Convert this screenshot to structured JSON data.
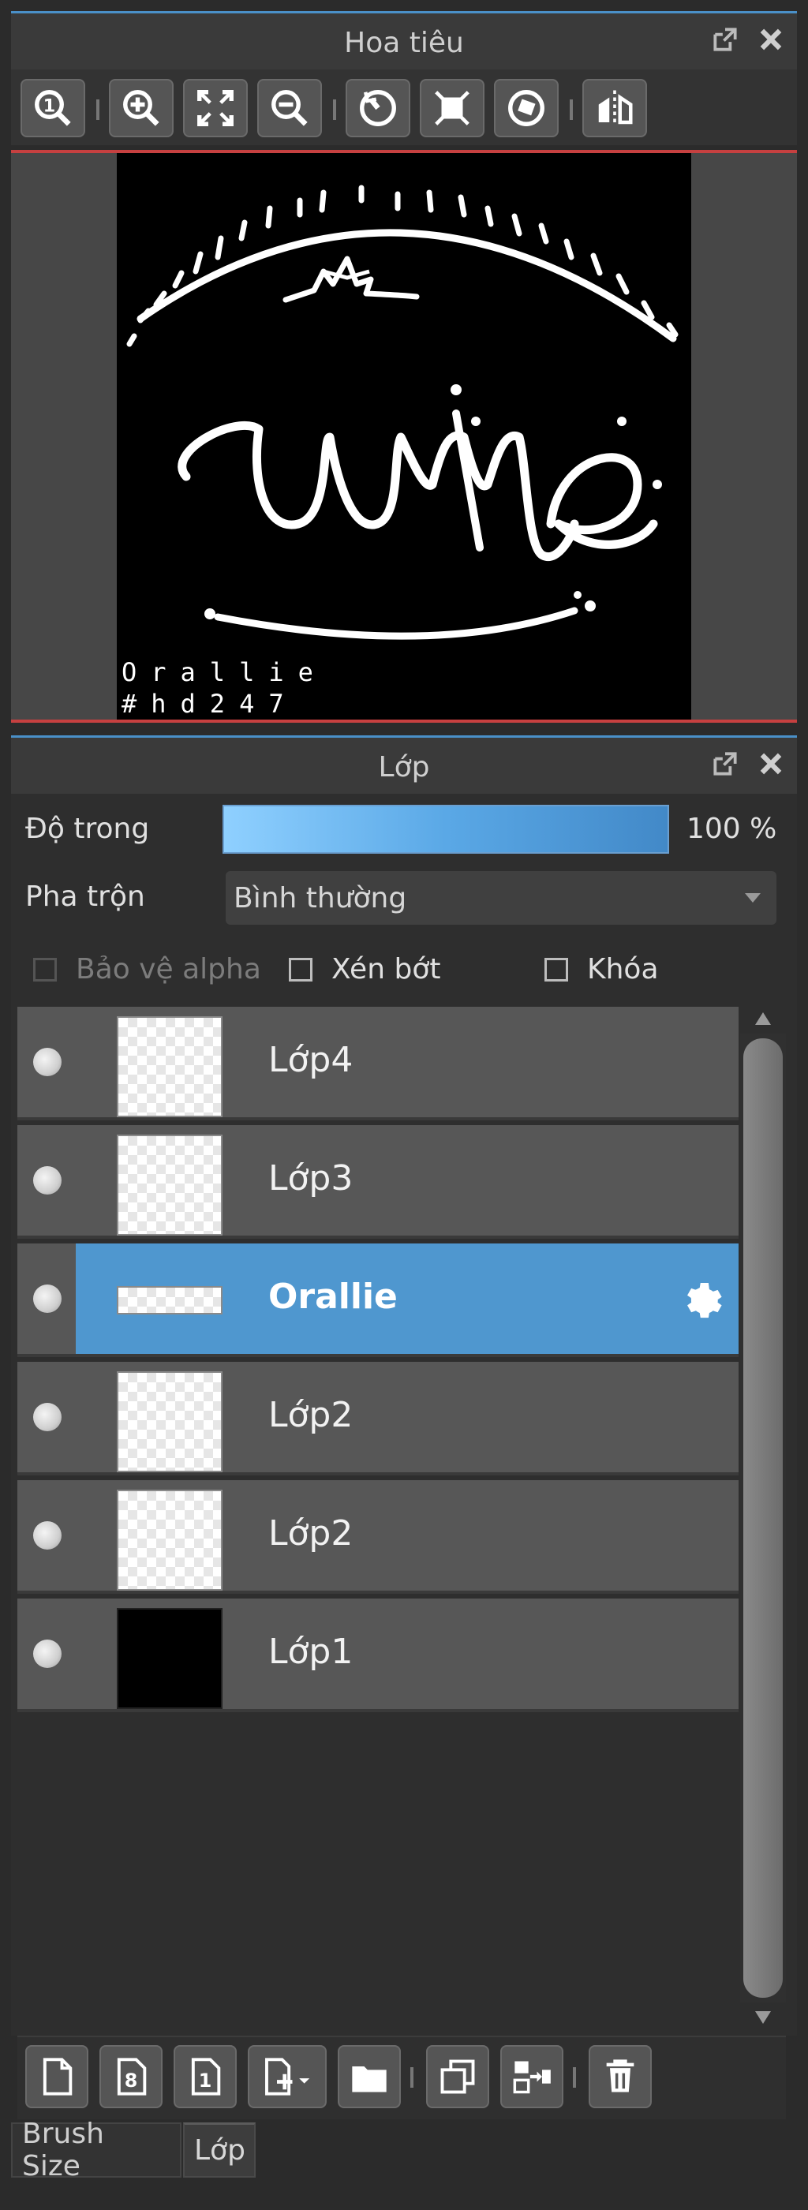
{
  "navigator": {
    "title": "Hoa tiêu",
    "toolbar": [
      {
        "icon": "zoom-actual-icon"
      },
      {
        "icon": "zoom-in-icon"
      },
      {
        "icon": "fit-screen-icon"
      },
      {
        "icon": "zoom-out-icon"
      },
      {
        "icon": "rotate-left-icon"
      },
      {
        "icon": "reset-rotation-icon"
      },
      {
        "icon": "rotate-right-icon"
      },
      {
        "icon": "flip-horizontal-icon"
      }
    ],
    "canvas_text_line1": "Orallie",
    "canvas_text_line2": "#hd247"
  },
  "layers": {
    "title": "Lớp",
    "opacity_label": "Độ trong",
    "opacity_value": "100 %",
    "opacity_fraction": 1.0,
    "blend_label": "Pha trộn",
    "blend_value": "Bình thường",
    "protect_alpha_label": "Bảo vệ alpha",
    "clip_label": "Xén bớt",
    "lock_label": "Khóa",
    "items": [
      {
        "name": "Lớp4",
        "thumb": "transparent",
        "selected": false
      },
      {
        "name": "Lớp3",
        "thumb": "transparent",
        "selected": false
      },
      {
        "name": "Orallie",
        "thumb": "strip",
        "selected": true
      },
      {
        "name": "Lớp2",
        "thumb": "transparent",
        "selected": false
      },
      {
        "name": "Lớp2",
        "thumb": "transparent",
        "selected": false
      },
      {
        "name": "Lớp1",
        "thumb": "black",
        "selected": false
      }
    ],
    "bottom_toolbar": [
      {
        "icon": "new-layer-icon"
      },
      {
        "icon": "new-8bit-layer-icon"
      },
      {
        "icon": "new-1bit-layer-icon"
      },
      {
        "icon": "add-layer-menu-icon"
      },
      {
        "icon": "new-folder-icon"
      },
      {
        "icon": "duplicate-layer-icon"
      },
      {
        "icon": "merge-down-icon"
      },
      {
        "icon": "delete-layer-icon"
      }
    ]
  },
  "tabs": [
    "Brush Size",
    "Lớp"
  ],
  "colors": {
    "accent": "#4f97cf",
    "frame_red": "#c64040",
    "panel": "#3a3a3a"
  }
}
